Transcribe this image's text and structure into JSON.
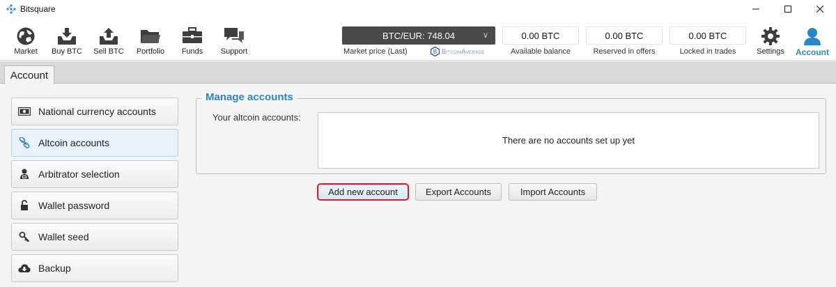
{
  "window": {
    "title": "Bitsquare"
  },
  "nav": {
    "items": [
      {
        "label": "Market",
        "icon": "globe-icon"
      },
      {
        "label": "Buy BTC",
        "icon": "buy-btc-icon"
      },
      {
        "label": "Sell BTC",
        "icon": "sell-btc-icon"
      },
      {
        "label": "Portfolio",
        "icon": "folder-icon"
      },
      {
        "label": "Funds",
        "icon": "briefcase-icon"
      },
      {
        "label": "Support",
        "icon": "chat-icon"
      }
    ],
    "market_price": {
      "value": "BTC/EUR: 748.04",
      "caption": "Market price (Last)",
      "provider": "BitcoinAverage"
    },
    "balances": [
      {
        "value": "0.00 BTC",
        "caption": "Available balance"
      },
      {
        "value": "0.00 BTC",
        "caption": "Reserved in offers"
      },
      {
        "value": "0.00 BTC",
        "caption": "Locked in trades"
      }
    ],
    "settings_label": "Settings",
    "account_label": "Account"
  },
  "tab": {
    "label": "Account"
  },
  "side_menu": {
    "items": [
      {
        "label": "National currency accounts",
        "icon": "banknote-icon"
      },
      {
        "label": "Altcoin accounts",
        "icon": "link-icon"
      },
      {
        "label": "Arbitrator selection",
        "icon": "arbitrator-icon"
      },
      {
        "label": "Wallet password",
        "icon": "lock-icon"
      },
      {
        "label": "Wallet seed",
        "icon": "key-icon"
      },
      {
        "label": "Backup",
        "icon": "cloud-download-icon"
      }
    ],
    "active_index": 1
  },
  "manage": {
    "title": "Manage accounts",
    "field_label": "Your altcoin accounts:",
    "empty_text": "There are no accounts set up yet",
    "buttons": {
      "add": "Add new account",
      "export": "Export Accounts",
      "import": "Import Accounts"
    }
  },
  "colors": {
    "accent": "#2a87c5",
    "price_box": "#4a4a4a",
    "focus_ring": "#d81e1e"
  }
}
